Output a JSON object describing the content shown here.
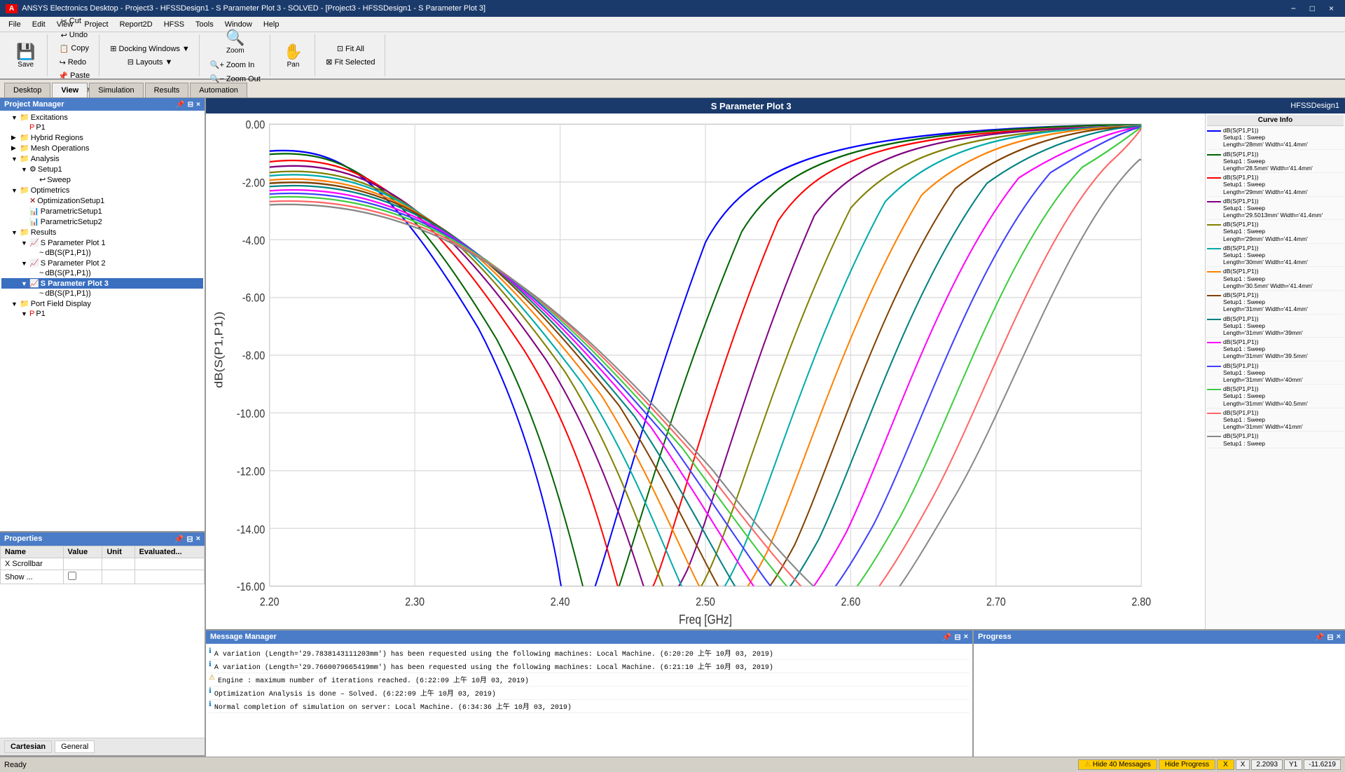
{
  "titlebar": {
    "title": "ANSYS Electronics Desktop - Project3 - HFSSDesign1 - S Parameter Plot 3 - SOLVED - [Project3 - HFSSDesign1 - S Parameter Plot 3]",
    "logo": "ANSYS",
    "controls": [
      "−",
      "□",
      "×"
    ]
  },
  "menubar": {
    "items": [
      "File",
      "Edit",
      "View",
      "Project",
      "Report2D",
      "HFSS",
      "Tools",
      "Window",
      "Help"
    ]
  },
  "toolbar": {
    "save_label": "Save",
    "cut_label": "Cut",
    "copy_label": "Copy",
    "paste_label": "Paste",
    "undo_label": "Undo",
    "redo_label": "Redo",
    "delete_label": "Delete",
    "docking_windows_label": "Docking Windows",
    "layouts_label": "Layouts",
    "zoom_label": "Zoom",
    "zoom_in_label": "Zoom In",
    "zoom_out_label": "Zoom Out",
    "pan_label": "Pan",
    "fit_all_label": "Fit All",
    "fit_selected_label": "Fit Selected"
  },
  "tabs": {
    "items": [
      "Desktop",
      "View",
      "Simulation",
      "Results",
      "Automation"
    ]
  },
  "project_manager": {
    "title": "Project Manager",
    "tree": [
      {
        "label": "Excitations",
        "indent": 1,
        "expanded": true,
        "icon": "📁"
      },
      {
        "label": "P1",
        "indent": 2,
        "icon": "📄",
        "color": "red"
      },
      {
        "label": "Hybrid Regions",
        "indent": 1,
        "icon": "📁"
      },
      {
        "label": "Mesh Operations",
        "indent": 1,
        "icon": "📁"
      },
      {
        "label": "Analysis",
        "indent": 1,
        "expanded": true,
        "icon": "📁"
      },
      {
        "label": "Setup1",
        "indent": 2,
        "expanded": true,
        "icon": "⚙"
      },
      {
        "label": "Sweep",
        "indent": 3,
        "icon": "↩"
      },
      {
        "label": "Optimetrics",
        "indent": 1,
        "expanded": true,
        "icon": "📁"
      },
      {
        "label": "OptimizationSetup1",
        "indent": 2,
        "icon": "✕"
      },
      {
        "label": "ParametricSetup1",
        "indent": 2,
        "icon": "📊"
      },
      {
        "label": "ParametricSetup2",
        "indent": 2,
        "icon": "📊"
      },
      {
        "label": "Results",
        "indent": 1,
        "expanded": true,
        "icon": "📁"
      },
      {
        "label": "S Parameter Plot 1",
        "indent": 2,
        "expanded": true,
        "icon": "📈"
      },
      {
        "label": "dB(S(P1,P1))",
        "indent": 3,
        "icon": "~"
      },
      {
        "label": "S Parameter Plot 2",
        "indent": 2,
        "expanded": true,
        "icon": "📈"
      },
      {
        "label": "dB(S(P1,P1))",
        "indent": 3,
        "icon": "~"
      },
      {
        "label": "S Parameter Plot 3",
        "indent": 2,
        "expanded": true,
        "icon": "📈",
        "bold": true
      },
      {
        "label": "dB(S(P1,P1))",
        "indent": 3,
        "icon": "~"
      },
      {
        "label": "Port Field Display",
        "indent": 1,
        "expanded": true,
        "icon": "📁"
      },
      {
        "label": "P1",
        "indent": 2,
        "icon": "📄"
      }
    ]
  },
  "properties": {
    "title": "Properties",
    "columns": [
      "Name",
      "Value",
      "Unit",
      "Evaluated..."
    ],
    "row_scrollbar": "X Scrollbar",
    "row_show": "Show ...",
    "checkbox_value": false
  },
  "cartesian_tabs": [
    "Cartesian",
    "General"
  ],
  "plot": {
    "title": "S Parameter Plot 3",
    "design_label": "HFSSDesign1",
    "x_axis_label": "Freq [GHz]",
    "y_axis_label": "dB(S(P1,P1))",
    "x_min": 2.2,
    "x_max": 2.8,
    "y_min": -16.0,
    "y_max": 0.0,
    "x_ticks": [
      "2.20",
      "2.30",
      "2.40",
      "2.50",
      "2.60",
      "2.70",
      "2.80"
    ],
    "y_ticks": [
      "0.00",
      "-2.00",
      "-4.00",
      "-6.00",
      "-8.00",
      "-10.00",
      "-12.00",
      "-14.00",
      "-16.00"
    ]
  },
  "legend": {
    "title": "Curve Info",
    "curves": [
      {
        "color": "#0000ff",
        "label": "dB(S(P1,P1))",
        "sub": "Setup1 : Sweep\nLength='28mm' Width='41.4mm'"
      },
      {
        "color": "#008000",
        "label": "dB(S(P1,P1))",
        "sub": "Setup1 : Sweep\nLength='28.5mm' Width='41.4mm'"
      },
      {
        "color": "#ff0000",
        "label": "dB(S(P1,P1))",
        "sub": "Setup1 : Sweep\nLength='29mm' Width='41.4mm'"
      },
      {
        "color": "#800080",
        "label": "dB(S(P1,P1))",
        "sub": "Setup1 : Sweep\nLength='29.5013mm' Width='41.4mm'"
      },
      {
        "color": "#808000",
        "label": "dB(S(P1,P1))",
        "sub": "Setup1 : Sweep\nLength='29mm' Width='41.4mm'"
      },
      {
        "color": "#00ffff",
        "label": "dB(S(P1,P1))",
        "sub": "Setup1 : Sweep\nLength='30mm' Width='41.4mm'"
      },
      {
        "color": "#ff8000",
        "label": "dB(S(P1,P1))",
        "sub": "Setup1 : Sweep\nLength='30.5mm' Width='41.4mm'"
      },
      {
        "color": "#804000",
        "label": "dB(S(P1,P1))",
        "sub": "Setup1 : Sweep\nLength='31mm' Width='41.4mm'"
      },
      {
        "color": "#008080",
        "label": "dB(S(P1,P1))",
        "sub": "Setup1 : Sweep\nLength='31mm' Width='39mm'"
      },
      {
        "color": "#ff00ff",
        "label": "dB(S(P1,P1))",
        "sub": "Setup1 : Sweep\nLength='31mm' Width='39.5mm'"
      },
      {
        "color": "#4040ff",
        "label": "dB(S(P1,P1))",
        "sub": "Setup1 : Sweep\nLength='31mm' Width='40mm'"
      },
      {
        "color": "#40ff40",
        "label": "dB(S(P1,P1))",
        "sub": "Setup1 : Sweep\nLength='31mm' Width='40.5mm'"
      },
      {
        "color": "#ff4040",
        "label": "dB(S(P1,P1))",
        "sub": "Setup1 : Sweep\nLength='31mm' Width='41mm'"
      },
      {
        "color": "#808080",
        "label": "dB(S(P1,P1))",
        "sub": "Setup1 : Sweep"
      }
    ]
  },
  "message_manager": {
    "title": "Message Manager",
    "messages": [
      {
        "type": "info",
        "text": "A variation (Length='29.7838143111203mm') has been requested using the following machines: Local Machine. (6:20:20 上午  10月 03, 2019)"
      },
      {
        "type": "info",
        "text": "A variation (Length='29.7660079665419mm') has been requested using the following machines: Local Machine. (6:21:10 上午  10月 03, 2019)"
      },
      {
        "type": "warn",
        "text": "Engine : maximum number of iterations reached. (6:22:09 上午  10月 03, 2019)"
      },
      {
        "type": "info",
        "text": "Optimization Analysis is done – Solved. (6:22:09 上午  10月 03, 2019)"
      },
      {
        "type": "info",
        "text": "Normal completion of simulation on server: Local Machine. (6:34:36 上午  10月 03, 2019)"
      }
    ]
  },
  "progress": {
    "title": "Progress"
  },
  "statusbar": {
    "status": "Ready",
    "hide_messages_label": "Hide 40 Messages",
    "hide_progress_label": "Hide Progress",
    "close": "X",
    "x_coord_label": "X",
    "x_coord_value": "2.2093",
    "y_coord_label": "Y1",
    "y_coord_value": "-11.6219"
  }
}
